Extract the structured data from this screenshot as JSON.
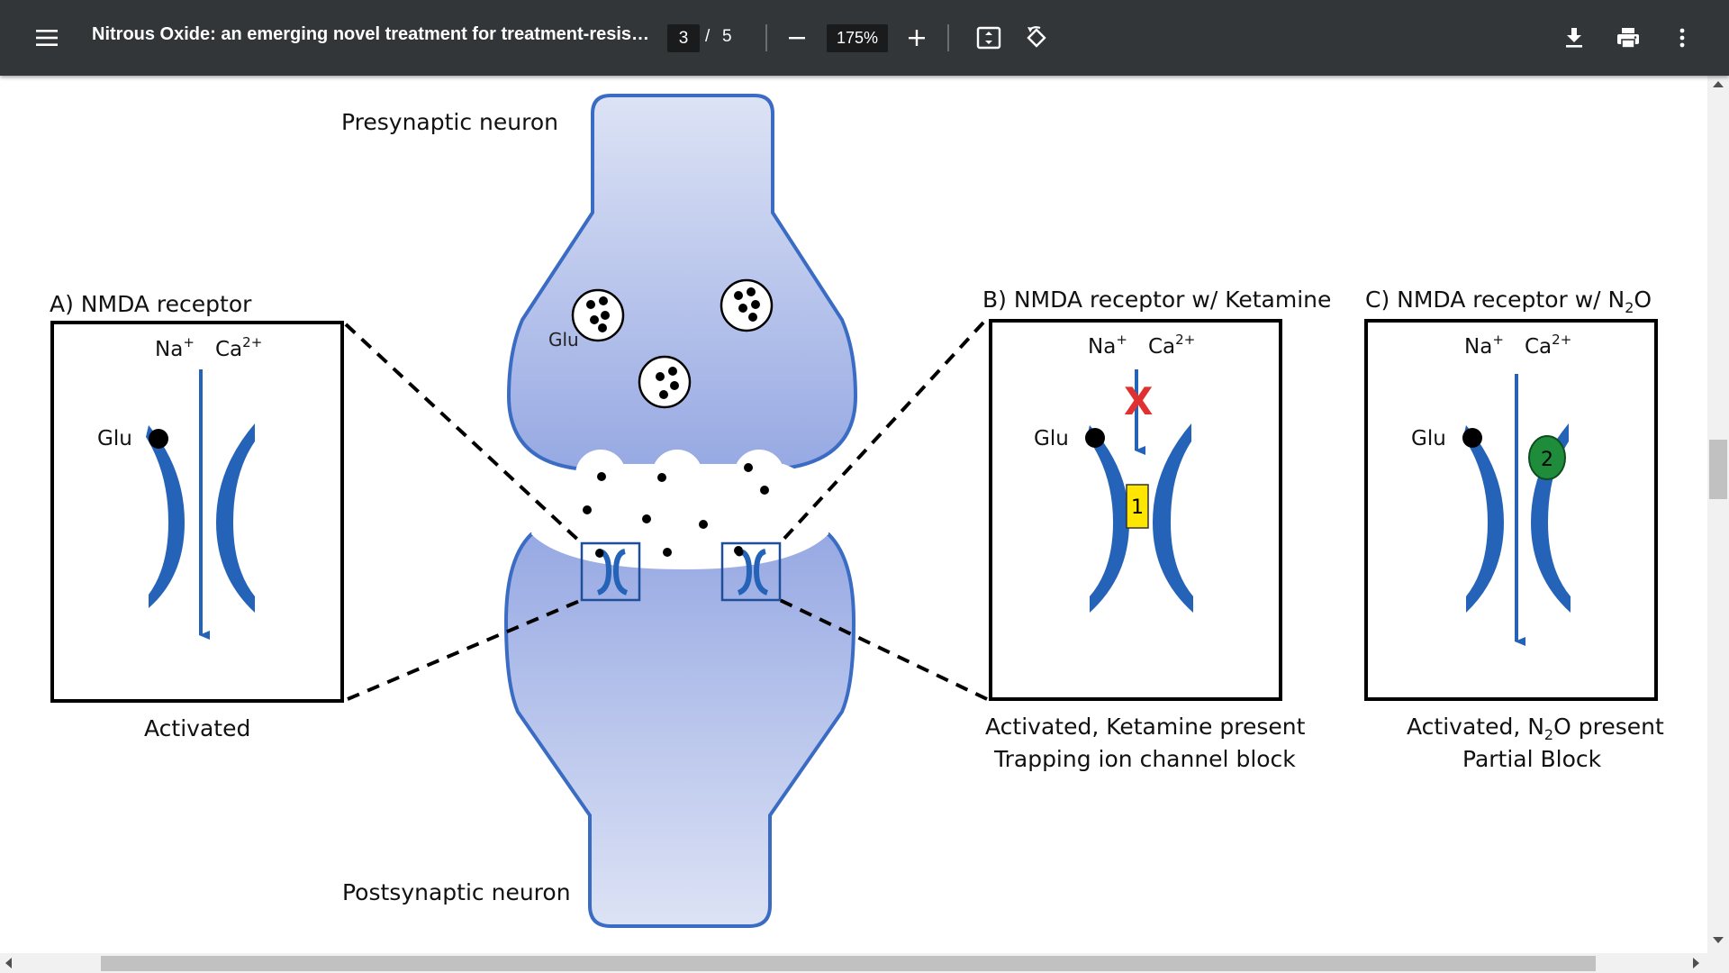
{
  "toolbar": {
    "menu_icon": "menu-icon",
    "title": "Nitrous Oxide: an emerging novel treatment for treatment-resist...",
    "current_page": "3",
    "page_separator": "/",
    "total_pages": "5",
    "zoom": "175%",
    "icons": [
      "zoom-out-icon",
      "zoom-in-icon",
      "fit-page-icon",
      "rotate-icon",
      "download-icon",
      "print-icon",
      "more-vert-icon"
    ]
  },
  "figure": {
    "presynaptic_label": "Presynaptic neuron",
    "postsynaptic_label": "Postsynaptic neuron",
    "vesicle_label": "Glu",
    "panel_a": {
      "title": "A) NMDA receptor",
      "na": "Na",
      "na_sup": "+",
      "ca": "Ca",
      "ca_sup": "2+",
      "glu": "Glu",
      "caption": "Activated"
    },
    "panel_b": {
      "title": "B) NMDA receptor w/ Ketamine",
      "na": "Na",
      "na_sup": "+",
      "ca": "Ca",
      "ca_sup": "2+",
      "glu": "Glu",
      "block_mark": "X",
      "site_label": "1",
      "caption_line1": "Activated, Ketamine present",
      "caption_line2": "Trapping ion channel block"
    },
    "panel_c": {
      "title_main": "C) NMDA receptor w/ N",
      "title_sub": "2",
      "title_end": "O",
      "na": "Na",
      "na_sup": "+",
      "ca": "Ca",
      "ca_sup": "2+",
      "glu": "Glu",
      "site_label": "2",
      "caption_main": "Activated, N",
      "caption_sub": "2",
      "caption_end": "O present",
      "caption_line2": "Partial Block"
    },
    "colors": {
      "neuron_fill_top": "#dde3f5",
      "neuron_fill_bottom": "#97a9e3",
      "neuron_outline": "#3b6cc4",
      "receptor": "#2563b8",
      "ketamine_block": "#ffe600",
      "n2o_site": "#1e8c3a",
      "block_x": "#e03030"
    }
  }
}
